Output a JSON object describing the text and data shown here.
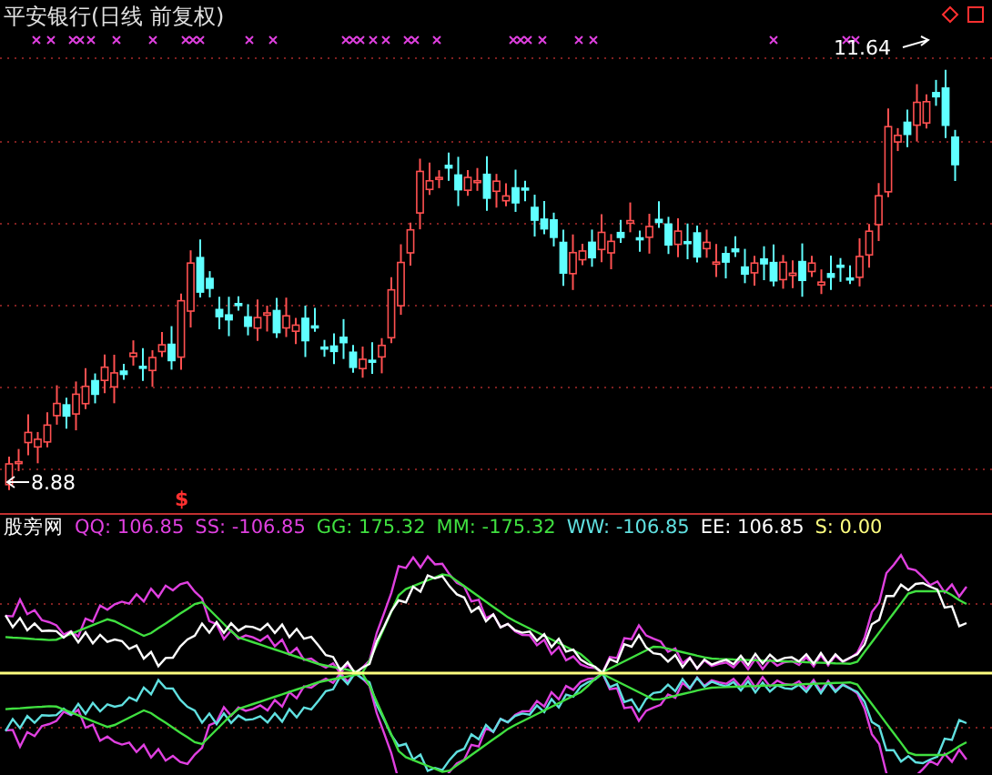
{
  "price_panel": {
    "title": "平安银行(日线 前复权)",
    "high_label": "11.64",
    "low_label": "8.88",
    "signal_mark": "$"
  },
  "indicator_panel": {
    "name": "股旁网",
    "values": [
      {
        "label": "QQ: 106.85",
        "color": "#e040e0"
      },
      {
        "label": "SS: -106.85",
        "color": "#e040e0"
      },
      {
        "label": "GG: 175.32",
        "color": "#40e040"
      },
      {
        "label": "MM: -175.32",
        "color": "#40e040"
      },
      {
        "label": "WW: -106.85",
        "color": "#60e0e0"
      },
      {
        "label": "EE: 106.85",
        "color": "#ffffff"
      },
      {
        "label": "S: 0.00",
        "color": "#ffff80"
      }
    ]
  }
}
